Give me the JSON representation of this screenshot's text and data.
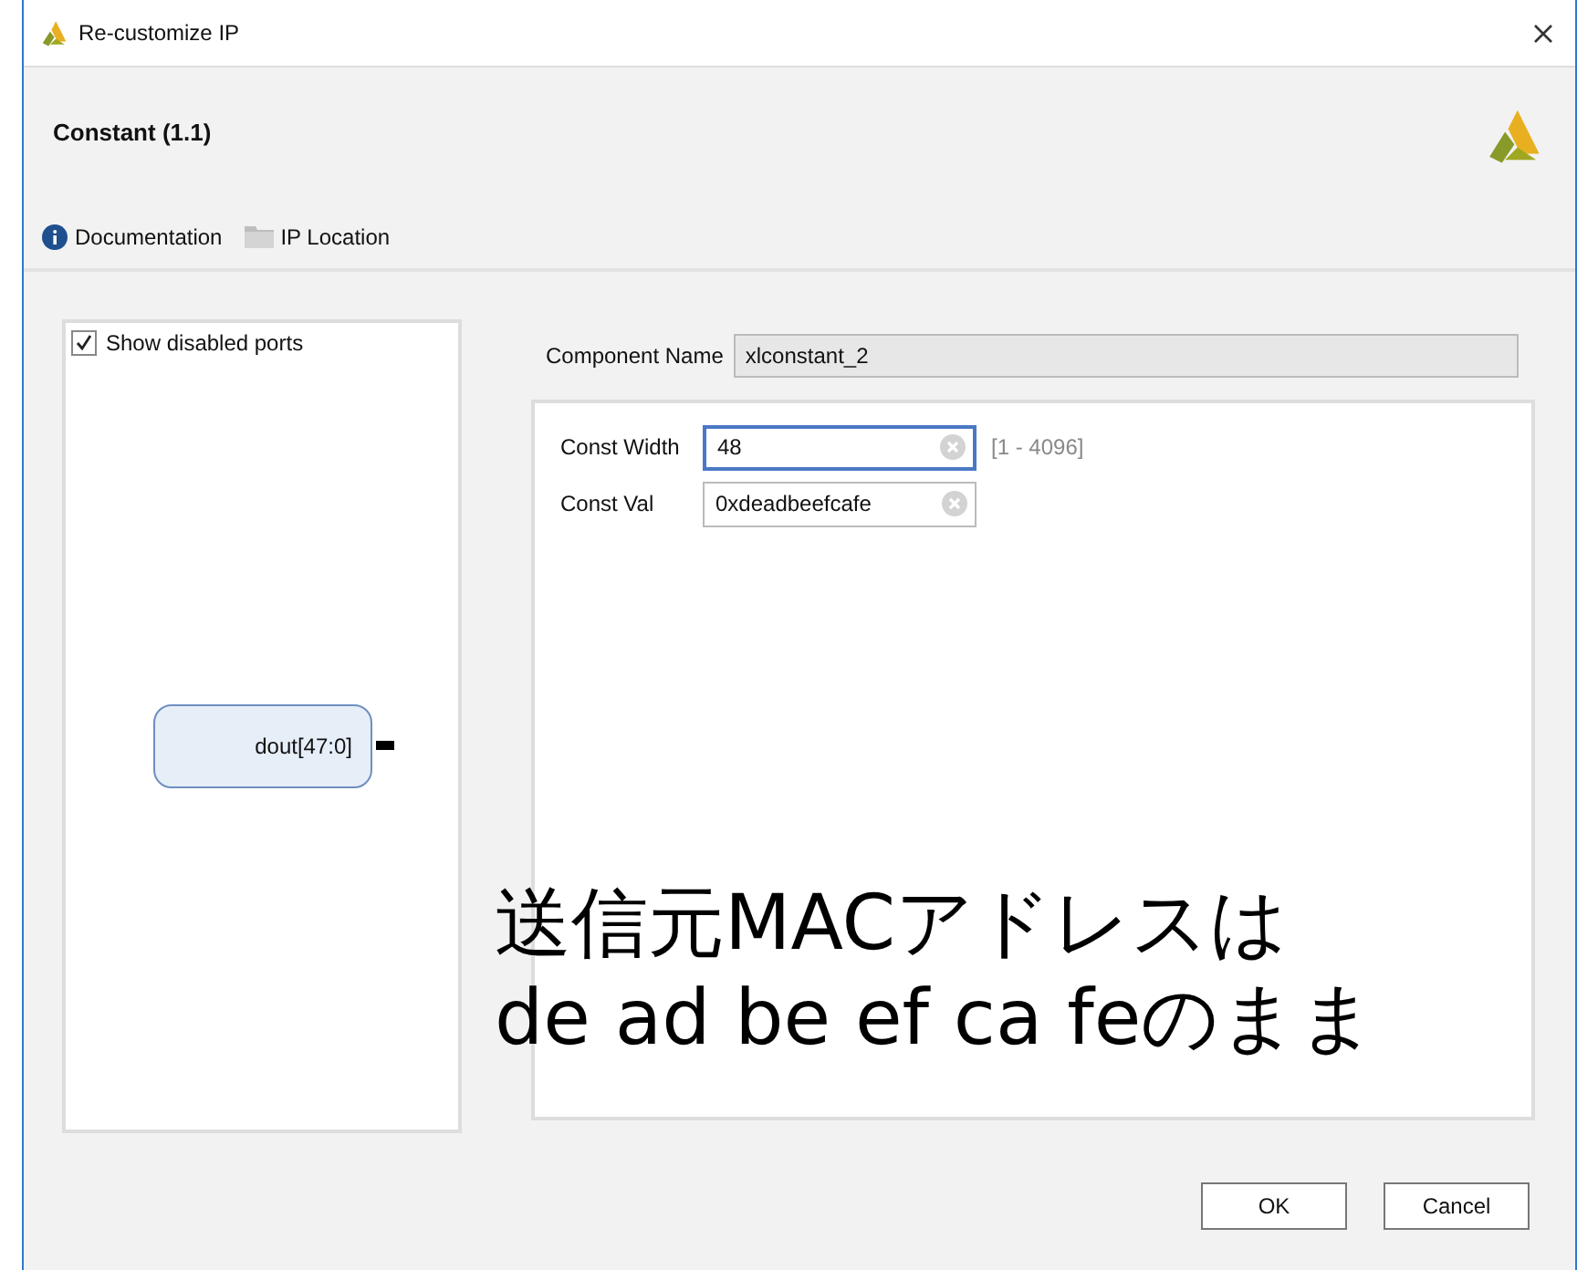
{
  "window": {
    "title": "Re-customize IP"
  },
  "header": {
    "title": "Constant (1.1)",
    "links": [
      {
        "label": "Documentation",
        "kind": "info"
      },
      {
        "label": "IP Location",
        "kind": "folder"
      }
    ]
  },
  "preview": {
    "show_disabled": {
      "label": "Show disabled ports",
      "checked": true
    },
    "port": "dout[47:0]"
  },
  "component_name": {
    "label": "Component Name",
    "value": "xlconstant_2",
    "disabled": true
  },
  "params": [
    {
      "label": "Const Width",
      "value": "48",
      "focused": true,
      "range": "[1 - 4096]"
    },
    {
      "label": "Const Val",
      "value": "0xdeadbeefcafe",
      "focused": false
    }
  ],
  "annotation": [
    "送信元MACアドレスは",
    "de ad be ef ca feのまま"
  ],
  "buttons": [
    "OK",
    "Cancel"
  ]
}
